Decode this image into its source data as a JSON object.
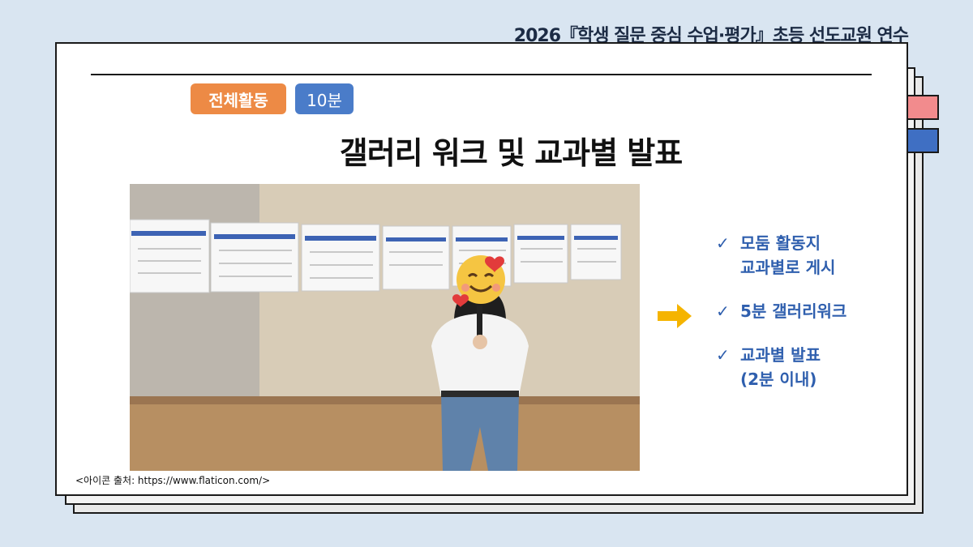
{
  "header": {
    "title": "2026『학생 질문 중심 수업·평가』초등 선도교원 연수"
  },
  "slide": {
    "badge_activity": "전체활동",
    "badge_time": "10분",
    "title": "갤러리 워크 및 교과별 발표",
    "checklist": [
      {
        "line1": "모둠 활동지",
        "line2": "교과별로 게시"
      },
      {
        "line1": "5분 갤러리워크",
        "line2": ""
      },
      {
        "line1": "교과별 발표",
        "line2": "(2분 이내)"
      }
    ],
    "check_icon": "checkmark-icon",
    "arrow_icon": "right-arrow-icon",
    "footnote": "<아이콘 출처: https://www.flaticon.com/>"
  },
  "colors": {
    "background": "#d9e5f1",
    "badge_orange": "#ed8a45",
    "badge_blue": "#4a7cc9",
    "check_text": "#2f5fae",
    "tab_pink": "#f28b8d",
    "tab_blue": "#3f6fc3",
    "arrow": "#f5b400"
  }
}
